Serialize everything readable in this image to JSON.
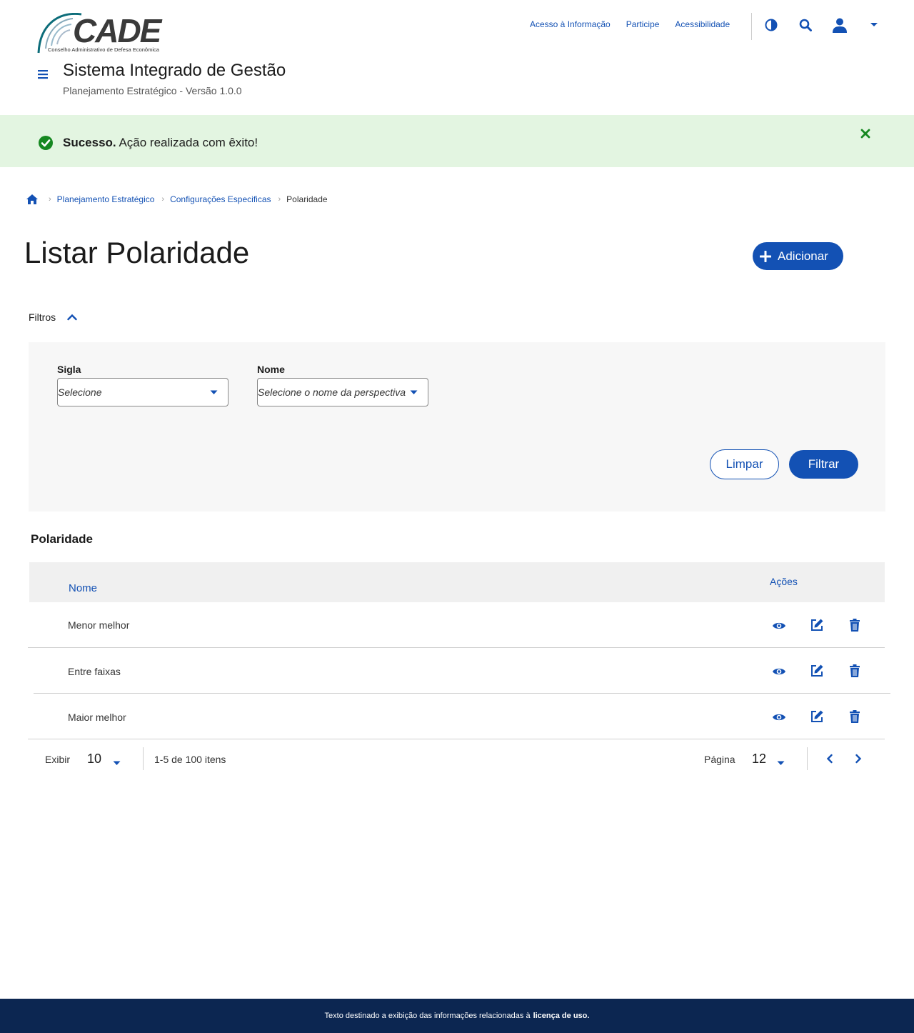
{
  "header": {
    "logo_text": "CADE",
    "logo_subtitle": "Conselho Administrativo de Defesa Econômica",
    "links": [
      "Acesso à Informação",
      "Participe",
      "Acessibilidade"
    ],
    "system_title": "Sistema Integrado de Gestão",
    "system_subtitle": "Planejamento Estratégico - Versão 1.0.0",
    "icons": [
      "contrast-icon",
      "search-icon",
      "user-icon",
      "caret-down-icon"
    ]
  },
  "alert": {
    "strong": "Sucesso.",
    "message": " Ação realizada com êxito!",
    "color": "#e3f5e1"
  },
  "breadcrumb": {
    "items": [
      "Planejamento Estratégico",
      "Configurações Especificas"
    ],
    "current": "Polaridade"
  },
  "page": {
    "title": "Listar Polaridade",
    "add_label": "Adicionar"
  },
  "filters": {
    "toggle_label": "Filtros",
    "sigla": {
      "label": "Sigla",
      "placeholder": "Selecione"
    },
    "nome": {
      "label": "Nome",
      "placeholder": "Selecione o nome da perspectiva"
    },
    "clear_label": "Limpar",
    "filter_label": "Filtrar"
  },
  "table": {
    "section_title": "Polaridade",
    "col_nome": "Nome",
    "col_acoes": "Ações",
    "rows": [
      "Menor melhor",
      "Entre faixas",
      "Maior melhor"
    ]
  },
  "pagination": {
    "show_label": "Exibir",
    "per_page": "10",
    "range": "1-5 de 100 itens",
    "page_label": "Página",
    "page": "12"
  },
  "footer": {
    "text": "Texto destinado a exibição das informações relacionadas à",
    "link": "licença de uso."
  },
  "colors": {
    "primary": "#1351b4",
    "footer": "#0c2651",
    "success": "#168821"
  }
}
